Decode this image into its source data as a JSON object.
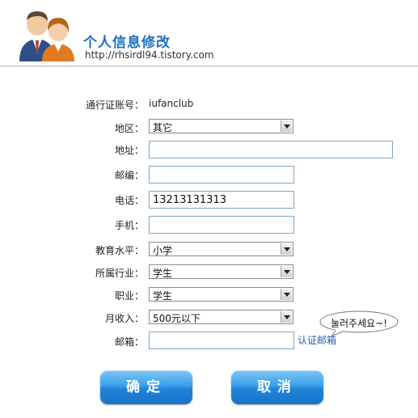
{
  "header": {
    "title": "个人信息修改",
    "url": "http://rhsirdl94.tistory.com"
  },
  "form": {
    "account_label": "通行证账号：",
    "account_value": "iufanclub",
    "region_label": "地区：",
    "region_value": "其它",
    "address_label": "地址：",
    "address_value": "",
    "zip_label": "邮编：",
    "zip_value": "",
    "phone_label": "电话：",
    "phone_value": "13213131313",
    "mobile_label": "手机：",
    "mobile_value": "",
    "education_label": "教育水平：",
    "education_value": "小学",
    "industry_label": "所属行业：",
    "industry_value": "学生",
    "job_label": "职业：",
    "job_value": "学生",
    "income_label": "月收入：",
    "income_value": "500元以下",
    "email_label": "邮箱：",
    "email_value": "",
    "verify_link": "认证邮箱",
    "bubble_text": "눌러주세요~!"
  },
  "buttons": {
    "confirm": "确定",
    "cancel": "取消"
  },
  "colors": {
    "title": "#1e6fbf",
    "link": "#2a5fa8",
    "button": "#2a90e0"
  }
}
